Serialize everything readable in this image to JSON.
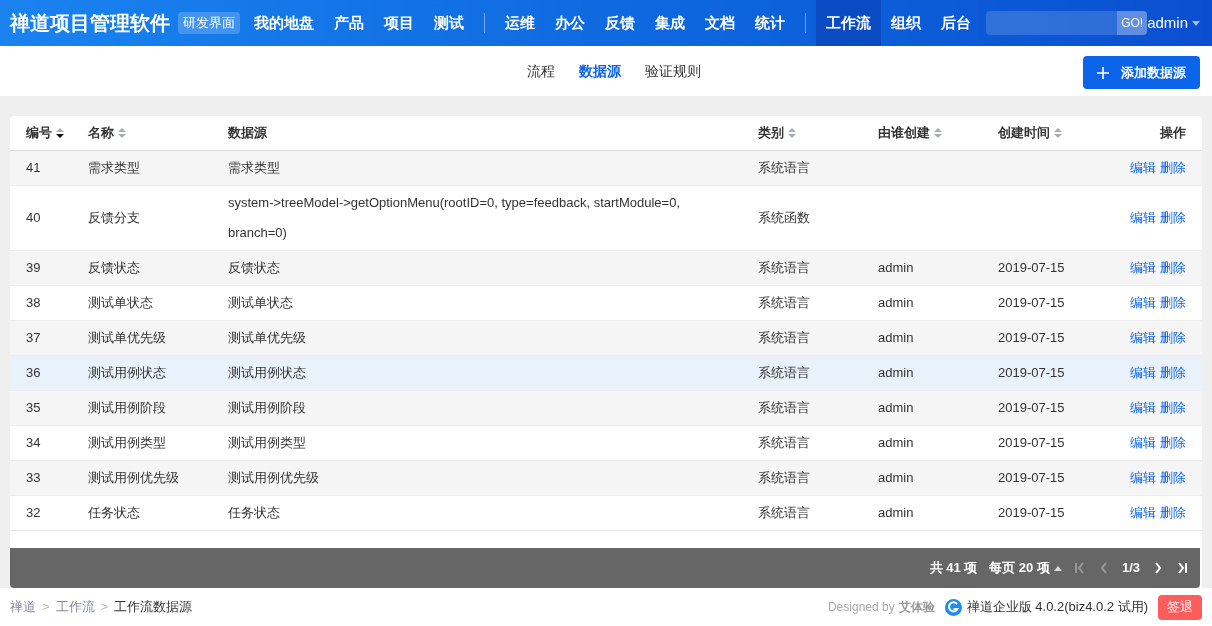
{
  "navbar": {
    "brand": "禅道项目管理软件",
    "badge": "研发界面",
    "groups": [
      [
        {
          "label": "我的地盘",
          "selected": false
        },
        {
          "label": "产品",
          "selected": false
        },
        {
          "label": "项目",
          "selected": false
        },
        {
          "label": "测试",
          "selected": false
        }
      ],
      [
        {
          "label": "运维",
          "selected": false
        },
        {
          "label": "办公",
          "selected": false
        },
        {
          "label": "反馈",
          "selected": false
        },
        {
          "label": "集成",
          "selected": false
        },
        {
          "label": "文档",
          "selected": false
        },
        {
          "label": "统计",
          "selected": false
        }
      ],
      [
        {
          "label": "工作流",
          "selected": true
        },
        {
          "label": "组织",
          "selected": false
        },
        {
          "label": "后台",
          "selected": false
        }
      ]
    ],
    "search_button": "GO!",
    "user": "admin"
  },
  "subnav": {
    "tabs": [
      {
        "label": "流程",
        "selected": false
      },
      {
        "label": "数据源",
        "selected": true
      },
      {
        "label": "验证规则",
        "selected": false
      }
    ],
    "add_button": "添加数据源"
  },
  "table": {
    "columns": [
      {
        "label": "编号",
        "sortable": true,
        "sorted": true
      },
      {
        "label": "名称",
        "sortable": true,
        "sorted": false
      },
      {
        "label": "数据源",
        "sortable": false
      },
      {
        "label": "类别",
        "sortable": true,
        "sorted": false
      },
      {
        "label": "由谁创建",
        "sortable": true,
        "sorted": false
      },
      {
        "label": "创建时间",
        "sortable": true,
        "sorted": false
      },
      {
        "label": "操作",
        "sortable": false
      }
    ],
    "rows": [
      {
        "id": "41",
        "name": "需求类型",
        "source": "需求类型",
        "category": "系统语言",
        "creator": "",
        "date": "",
        "actions": [
          "编辑",
          "删除"
        ],
        "highlighted": false
      },
      {
        "id": "40",
        "name": "反馈分支",
        "source": "system->treeModel->getOptionMenu(rootID=0, type=feedback, startModule=0, branch=0)",
        "category": "系统函数",
        "creator": "",
        "date": "",
        "actions": [
          "编辑",
          "删除"
        ],
        "highlighted": false
      },
      {
        "id": "39",
        "name": "反馈状态",
        "source": "反馈状态",
        "category": "系统语言",
        "creator": "admin",
        "date": "2019-07-15",
        "actions": [
          "编辑",
          "删除"
        ],
        "highlighted": false
      },
      {
        "id": "38",
        "name": "测试单状态",
        "source": "测试单状态",
        "category": "系统语言",
        "creator": "admin",
        "date": "2019-07-15",
        "actions": [
          "编辑",
          "删除"
        ],
        "highlighted": false
      },
      {
        "id": "37",
        "name": "测试单优先级",
        "source": "测试单优先级",
        "category": "系统语言",
        "creator": "admin",
        "date": "2019-07-15",
        "actions": [
          "编辑",
          "删除"
        ],
        "highlighted": false
      },
      {
        "id": "36",
        "name": "测试用例状态",
        "source": "测试用例状态",
        "category": "系统语言",
        "creator": "admin",
        "date": "2019-07-15",
        "actions": [
          "编辑",
          "删除"
        ],
        "highlighted": true
      },
      {
        "id": "35",
        "name": "测试用例阶段",
        "source": "测试用例阶段",
        "category": "系统语言",
        "creator": "admin",
        "date": "2019-07-15",
        "actions": [
          "编辑",
          "删除"
        ],
        "highlighted": false
      },
      {
        "id": "34",
        "name": "测试用例类型",
        "source": "测试用例类型",
        "category": "系统语言",
        "creator": "admin",
        "date": "2019-07-15",
        "actions": [
          "编辑",
          "删除"
        ],
        "highlighted": false
      },
      {
        "id": "33",
        "name": "测试用例优先级",
        "source": "测试用例优先级",
        "category": "系统语言",
        "creator": "admin",
        "date": "2019-07-15",
        "actions": [
          "编辑",
          "删除"
        ],
        "highlighted": false
      },
      {
        "id": "32",
        "name": "任务状态",
        "source": "任务状态",
        "category": "系统语言",
        "creator": "admin",
        "date": "2019-07-15",
        "actions": [
          "编辑",
          "删除"
        ],
        "highlighted": false
      }
    ]
  },
  "pager": {
    "total": "共 41 项",
    "per_page": "每页 20 项",
    "page": "1/3",
    "first_disabled": true,
    "prev_disabled": true,
    "next_disabled": false,
    "last_disabled": false
  },
  "footer": {
    "breadcrumb": [
      "禅道",
      "工作流",
      "工作流数据源"
    ],
    "separator": ">",
    "designed_by": "Designed by",
    "designer": "艾体验",
    "version": "禅道企业版 4.0.2(biz4.0.2 试用)",
    "logout": "签退"
  }
}
